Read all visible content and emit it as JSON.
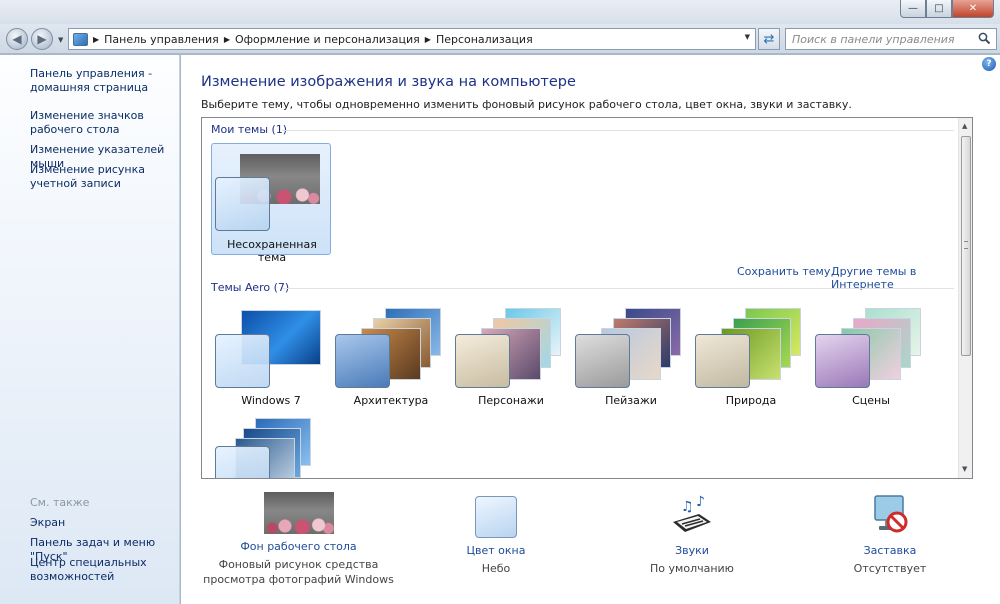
{
  "window": {
    "minimize_icon": "minimize-icon",
    "maximize_icon": "maximize-icon",
    "close_icon": "close-icon"
  },
  "toolbar": {
    "breadcrumbs": [
      "Панель управления",
      "Оформление и персонализация",
      "Персонализация"
    ],
    "search_placeholder": "Поиск в панели управления"
  },
  "sidebar": {
    "home_link": "Панель управления - домашняя страница",
    "links": [
      "Изменение значков рабочего стола",
      "Изменение указателей мыши",
      "Изменение рисунка учетной записи"
    ],
    "see_also_label": "См. также",
    "see_also_links": [
      "Экран",
      "Панель задач и меню \"Пуск\"",
      "Центр специальных возможностей"
    ]
  },
  "main": {
    "title": "Изменение изображения и звука на компьютере",
    "description": "Выберите тему, чтобы одновременно изменить фоновый рисунок рабочего стола, цвет окна, звуки и заставку.",
    "my_themes": {
      "label": "Мои темы (1)",
      "items": [
        {
          "name": "Несохраненная тема",
          "selected": true
        }
      ]
    },
    "save_theme_link": "Сохранить тему",
    "online_themes_link": "Другие темы в Интернете",
    "aero_themes": {
      "label": "Темы Aero (7)",
      "items": [
        {
          "name": "Windows 7",
          "colors": [
            "#1a6dc7",
            "#3a9cf0"
          ]
        },
        {
          "name": "Архитектура",
          "colors": [
            "#2d6fb8",
            "#c98a4a"
          ]
        },
        {
          "name": "Персонажи",
          "colors": [
            "#7fd0e8",
            "#f0c8a0"
          ]
        },
        {
          "name": "Пейзажи",
          "colors": [
            "#3a4a8a",
            "#c07a6a"
          ]
        },
        {
          "name": "Природа",
          "colors": [
            "#3aa050",
            "#d8e860"
          ]
        },
        {
          "name": "Сцены",
          "colors": [
            "#a8e0d0",
            "#e8a8c8"
          ]
        },
        {
          "name": "",
          "colors": [
            "#2a6ab8",
            "#8ac0f0"
          ]
        }
      ]
    }
  },
  "bottom": [
    {
      "label": "Фон рабочего стола",
      "sub": "Фоновый рисунок средства просмотра фотографий Windows",
      "icon": "desktop-background-icon"
    },
    {
      "label": "Цвет окна",
      "sub": "Небо",
      "icon": "window-color-icon"
    },
    {
      "label": "Звуки",
      "sub": "По умолчанию",
      "icon": "sounds-icon"
    },
    {
      "label": "Заставка",
      "sub": "Отсутствует",
      "icon": "screensaver-icon"
    }
  ]
}
